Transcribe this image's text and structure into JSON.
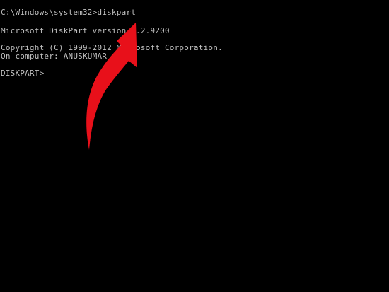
{
  "console": {
    "lines": [
      "C:\\Windows\\system32>diskpart",
      "Microsoft DiskPart version 6.2.9200",
      "Copyright (C) 1999-2012 Microsoft Corporation.",
      "On computer: ANUSKUMAR",
      "DISKPART>"
    ],
    "text_color": "#c0c0c0",
    "background_color": "#000000"
  },
  "annotation": {
    "icon": "red-arrow-icon",
    "color": "#e8101a"
  }
}
